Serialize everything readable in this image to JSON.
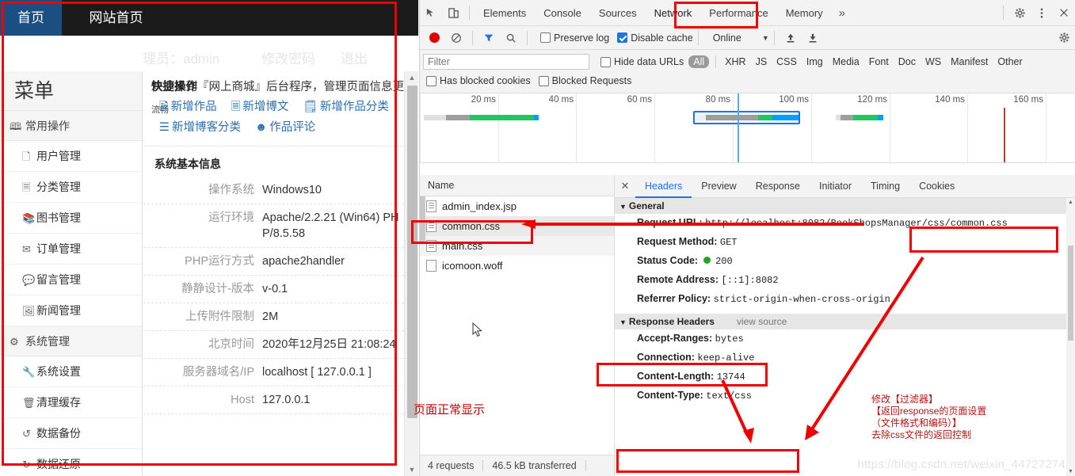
{
  "browser": {
    "tabs": [
      {
        "label": "首页",
        "active": true
      },
      {
        "label": "网站首页",
        "active": false
      }
    ],
    "admin_bar": {
      "user": "理员：admin",
      "change_password": "修改密码",
      "logout": "退出"
    },
    "sidebar": {
      "title": "菜单",
      "group": {
        "icon": "contact-book-icon",
        "label": "常用操作"
      },
      "items": [
        {
          "icon": "file-icon",
          "label": "用户管理"
        },
        {
          "icon": "list-icon",
          "label": "分类管理"
        },
        {
          "icon": "books-icon",
          "label": "图书管理"
        },
        {
          "icon": "envelope-icon",
          "label": "订单管理"
        },
        {
          "icon": "comment-icon",
          "label": "留言管理"
        },
        {
          "icon": "image-icon",
          "label": "新闻管理"
        },
        {
          "icon": "gear-icon",
          "label": "系统管理",
          "group": true
        },
        {
          "icon": "wrench-icon",
          "label": "系统设置"
        },
        {
          "icon": "trash-icon",
          "label": "清理缓存"
        },
        {
          "icon": "refresh-icon",
          "label": "数据备份"
        },
        {
          "icon": "restore-icon",
          "label": "数据还原"
        }
      ]
    },
    "content": {
      "welcome": "欢迎来到『网上商城』后台程序，管理页面信息更",
      "quick_label": "快捷操作",
      "fluent_label": "流畅",
      "quick_links": [
        {
          "icon": "add-work-icon",
          "label": "新增作品"
        },
        {
          "icon": "add-article-icon",
          "label": "新增博文"
        },
        {
          "icon": "add-category-icon",
          "label": "新增作品分类"
        },
        {
          "icon": "add-blogcat-icon",
          "label": "新增博客分类"
        },
        {
          "icon": "comment-icon",
          "label": "作品评论"
        }
      ],
      "sysinfo_title": "系统基本信息",
      "sysinfo": [
        {
          "key": "操作系统",
          "value": "Windows10"
        },
        {
          "key": "运行环境",
          "value": "Apache/2.2.21 (Win64) PHP/8.5.58"
        },
        {
          "key": "PHP运行方式",
          "value": "apache2handler"
        },
        {
          "key": "静静设计-版本",
          "value": "v-0.1"
        },
        {
          "key": "上传附件限制",
          "value": "2M"
        },
        {
          "key": "北京时间",
          "value": "2020年12月25日 21:08:24"
        },
        {
          "key": "服务器域名/IP",
          "value": "localhost [ 127.0.0.1 ]"
        },
        {
          "key": "Host",
          "value": "127.0.0.1"
        }
      ]
    }
  },
  "devtools": {
    "toolbar": {
      "inspect_icon": "inspect-element-icon",
      "device_icon": "device-toolbar-icon",
      "tabs": [
        {
          "label": "Elements",
          "selected": false
        },
        {
          "label": "Console",
          "selected": false
        },
        {
          "label": "Sources",
          "selected": false
        },
        {
          "label": "Network",
          "selected": true
        },
        {
          "label": "Performance",
          "selected": false
        },
        {
          "label": "Memory",
          "selected": false
        }
      ],
      "more_tabs": "»",
      "settings_icon": "gear-icon",
      "menu_icon": "kebab-menu-icon",
      "close_icon": "close-icon"
    },
    "controls": {
      "record_icon": "record-button",
      "clear_icon": "clear-icon",
      "filter_icon": "filter-funnel-icon",
      "search_icon": "search-icon",
      "preserve_log": {
        "label": "Preserve log",
        "checked": false
      },
      "disable_cache": {
        "label": "Disable cache",
        "checked": true
      },
      "throttling": "Online",
      "import_icon": "import-har-icon",
      "export_icon": "export-har-icon",
      "settings_icon": "gear-icon"
    },
    "filters": {
      "placeholder": "Filter",
      "hide_data_urls": {
        "label": "Hide data URLs",
        "checked": false
      },
      "types": [
        "All",
        "XHR",
        "JS",
        "CSS",
        "Img",
        "Media",
        "Font",
        "Doc",
        "WS",
        "Manifest",
        "Other"
      ],
      "selected_type": "All",
      "has_blocked_cookies": {
        "label": "Has blocked cookies",
        "checked": false
      },
      "blocked_requests": {
        "label": "Blocked Requests",
        "checked": false
      }
    },
    "overview": {
      "ticks": [
        "20 ms",
        "40 ms",
        "60 ms",
        "80 ms",
        "100 ms",
        "120 ms",
        "140 ms",
        "160 ms"
      ]
    },
    "requests": {
      "column_name": "Name",
      "rows": [
        {
          "name": "admin_index.jsp",
          "icon": "doc-file-icon",
          "selected": false
        },
        {
          "name": "common.css",
          "icon": "css-file-icon",
          "selected": true
        },
        {
          "name": "main.css",
          "icon": "css-file-icon",
          "selected": false
        },
        {
          "name": "icomoon.woff",
          "icon": "font-file-icon",
          "selected": false
        }
      ],
      "footer": {
        "count": "4 requests",
        "transferred": "46.5 kB transferred"
      }
    },
    "detail": {
      "close_icon": "close-icon",
      "tabs": [
        {
          "label": "Headers",
          "selected": true
        },
        {
          "label": "Preview",
          "selected": false
        },
        {
          "label": "Response",
          "selected": false
        },
        {
          "label": "Initiator",
          "selected": false
        },
        {
          "label": "Timing",
          "selected": false
        },
        {
          "label": "Cookies",
          "selected": false
        }
      ],
      "general": {
        "title": "General",
        "rows": [
          {
            "key": "Request URL:",
            "value": "http://localhost:8082/BookShopsManager/css/common.css"
          },
          {
            "key": "Request Method:",
            "value": "GET"
          },
          {
            "key": "Status Code:",
            "value": "200",
            "status_dot": "#25a325"
          },
          {
            "key": "Remote Address:",
            "value": "[::1]:8082"
          },
          {
            "key": "Referrer Policy:",
            "value": "strict-origin-when-cross-origin"
          }
        ]
      },
      "response_headers": {
        "title": "Response Headers",
        "view_source": "view source",
        "rows": [
          {
            "key": "Accept-Ranges:",
            "value": "bytes"
          },
          {
            "key": "Connection:",
            "value": "keep-alive"
          },
          {
            "key": "Content-Length:",
            "value": "13744"
          },
          {
            "key": "Content-Type:",
            "value": "text/css"
          }
        ]
      }
    },
    "watermark": "https://blog.csdn.net/weixin_44727274"
  },
  "annotations": {
    "page_ok": "页面正常显示",
    "note": "修改【过滤器】\n【返回response的页面设置\n（文件格式和编码）】\n去除css文件的返回控制",
    "accent_red": "#ee0000",
    "note_red": "#c00000"
  }
}
